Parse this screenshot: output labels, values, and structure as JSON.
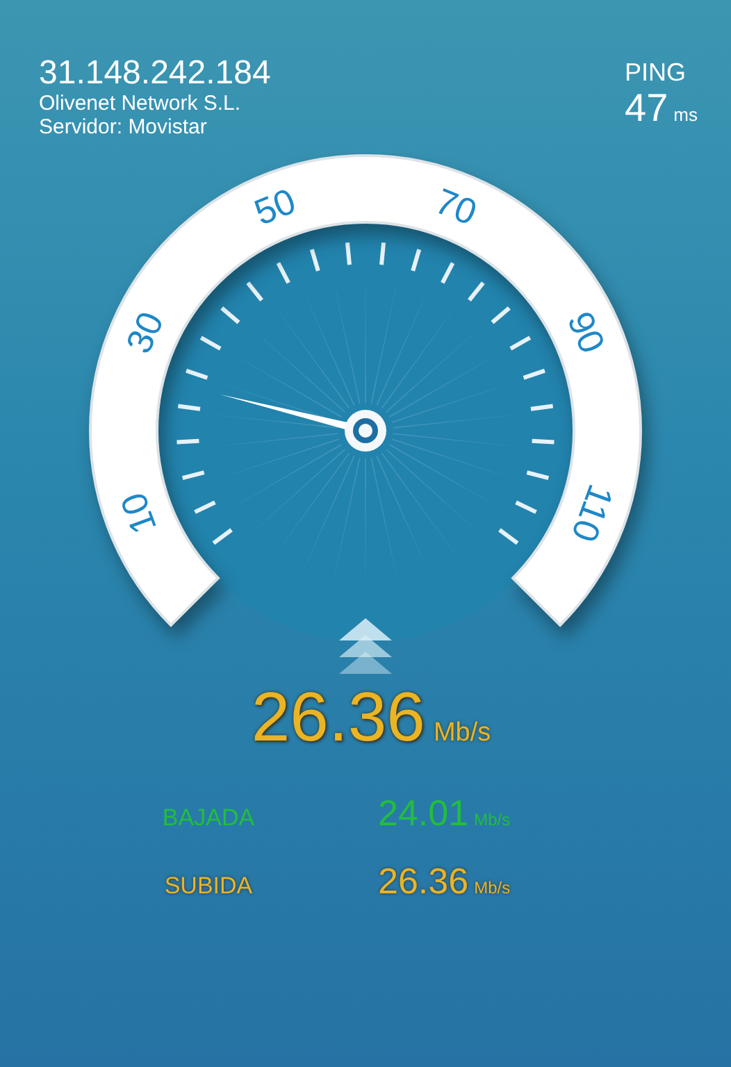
{
  "server": {
    "ip": "31.148.242.184",
    "isp": "Olivenet Network S.L.",
    "name": "Servidor: Movistar"
  },
  "ping": {
    "label": "PING",
    "value": "47",
    "unit": "ms"
  },
  "gauge": {
    "labels": [
      "10",
      "30",
      "50",
      "70",
      "90",
      "110"
    ]
  },
  "result": {
    "value": "26.36",
    "unit": "Mb/s"
  },
  "rows": [
    {
      "kind": "download",
      "label": "BAJADA",
      "value": "24.01",
      "unit": "Mb/s"
    },
    {
      "kind": "upload",
      "label": "SUBIDA",
      "value": "26.36",
      "unit": "Mb/s"
    }
  ]
}
